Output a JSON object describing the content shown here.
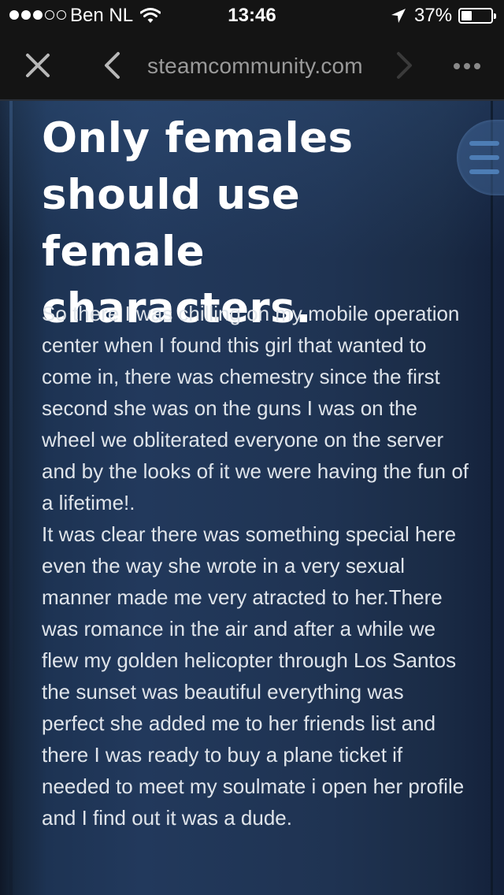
{
  "status_bar": {
    "carrier": "Ben NL",
    "time": "13:46",
    "battery_percent": "37%",
    "signal_bars_filled": 3,
    "signal_bars_total": 5,
    "battery_level": 0.37
  },
  "browser": {
    "url": "steamcommunity.com",
    "icons": {
      "close": "close-icon",
      "back": "chevron-left-icon",
      "forward": "chevron-right-icon",
      "more": "more-dots-icon"
    }
  },
  "post": {
    "title": "Only females should use female characters.",
    "body": "So there I was chilling on my mobile operation center when I found this girl that wanted to come in, there was chemestry since the first second she was on the guns I was on the wheel we obliterated everyone on the server and by the looks of it we were having the fun of a lifetime!.\nIt was clear there was something special here even the way she wrote in a very sexual manner made me very atracted to her.There was romance in the air and after a while we flew my golden helicopter through Los Santos the sunset was beautiful everything was perfect she added me to her friends list and there I was ready to buy a plane ticket if needed to meet my soulmate i open her profile and I find out it was a dude."
  },
  "menu": {
    "icon": "hamburger-menu-icon"
  },
  "colors": {
    "title": "#ffffff",
    "body_text": "#dfe4ea",
    "page_bg": "#1f3352",
    "chrome_bg": "#141414",
    "url_text": "#9a9a9a",
    "menu_line": "#4d7db5"
  }
}
